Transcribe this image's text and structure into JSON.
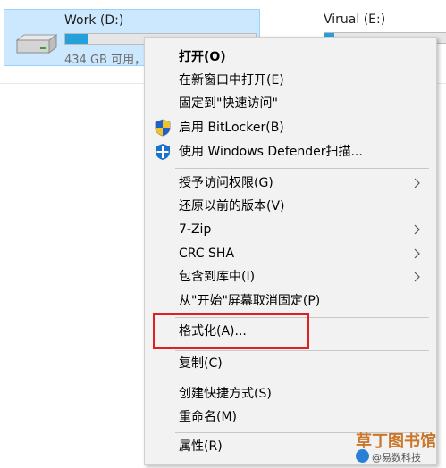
{
  "drives": [
    {
      "name": "Work (D:)",
      "free_text": "434 GB 可用，",
      "usage_fraction": 0.12,
      "selected": true
    },
    {
      "name": "Virual (E:)",
      "free_text": "",
      "usage_fraction": 0.07,
      "selected": false
    }
  ],
  "context_menu": {
    "items": [
      {
        "label": "打开(O)",
        "bold": true,
        "icon": null,
        "submenu": false
      },
      {
        "label": "在新窗口中打开(E)",
        "icon": null,
        "submenu": false
      },
      {
        "label": "固定到\"快速访问\"",
        "icon": null,
        "submenu": false
      },
      {
        "label": "启用 BitLocker(B)",
        "icon": "shield-icon",
        "submenu": false
      },
      {
        "label": "使用 Windows Defender扫描...",
        "icon": "defender-icon",
        "submenu": false
      },
      {
        "label": "授予访问权限(G)",
        "icon": null,
        "submenu": true
      },
      {
        "label": "还原以前的版本(V)",
        "icon": null,
        "submenu": false
      },
      {
        "label": "7-Zip",
        "icon": null,
        "submenu": true
      },
      {
        "label": "CRC SHA",
        "icon": null,
        "submenu": true
      },
      {
        "label": "包含到库中(I)",
        "icon": null,
        "submenu": true
      },
      {
        "label": "从\"开始\"屏幕取消固定(P)",
        "icon": null,
        "submenu": false
      },
      {
        "label": "格式化(A)...",
        "icon": null,
        "submenu": false,
        "highlighted": true
      },
      {
        "label": "复制(C)",
        "icon": null,
        "submenu": false
      },
      {
        "label": "创建快捷方式(S)",
        "icon": null,
        "submenu": false
      },
      {
        "label": "重命名(M)",
        "icon": null,
        "submenu": false
      },
      {
        "label": "属性(R)",
        "icon": null,
        "submenu": false
      }
    ]
  },
  "highlight_color": "#e02020",
  "watermark": {
    "line1": "草丁图书馆",
    "line2": "@易数科技"
  }
}
